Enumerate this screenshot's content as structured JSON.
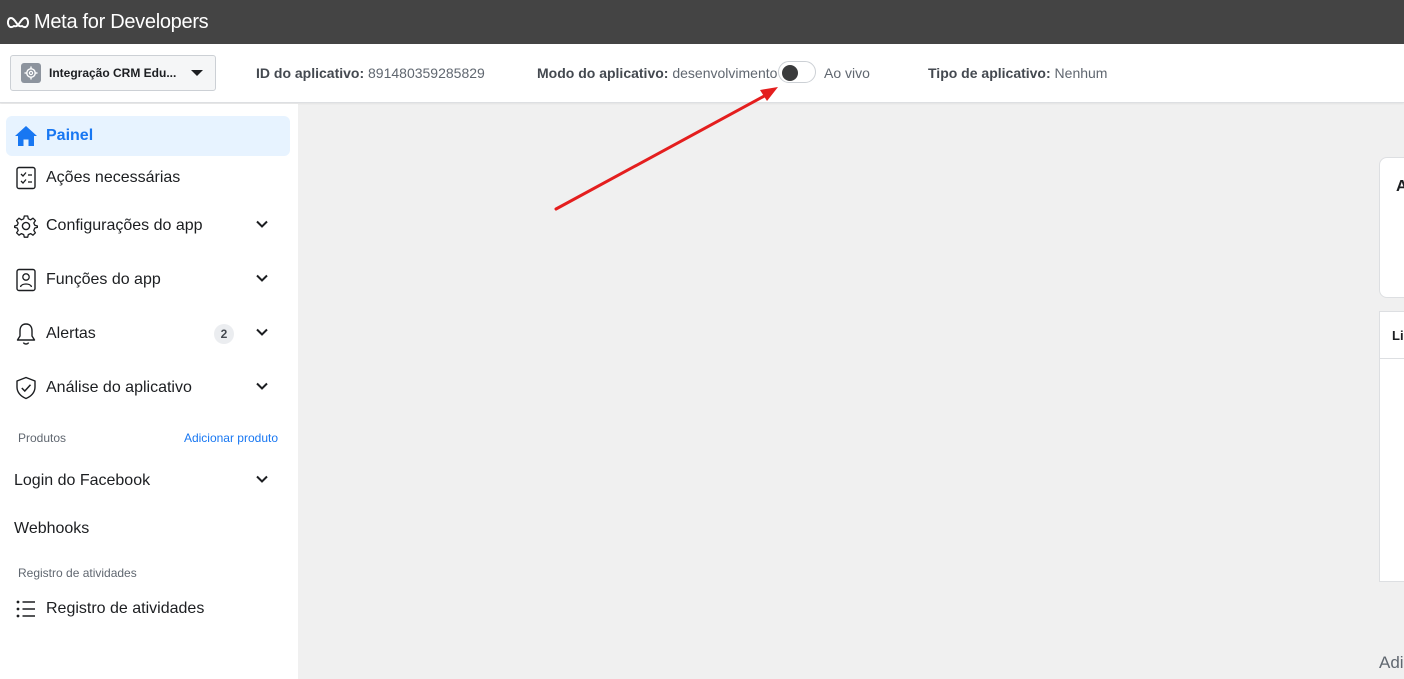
{
  "brand": {
    "name": "Meta for Developers"
  },
  "app_bar": {
    "app_name": "Integração CRM Edu...",
    "app_id_label": "ID do aplicativo:",
    "app_id_value": "891480359285829",
    "mode_label": "Modo do aplicativo:",
    "mode_value": "desenvolvimento",
    "mode_live_label": "Ao vivo",
    "mode_is_live": false,
    "type_label": "Tipo de aplicativo:",
    "type_value": "Nenhum"
  },
  "sidebar": {
    "items": [
      {
        "label": "Painel",
        "icon": "home-icon",
        "active": true
      },
      {
        "label": "Ações necessárias",
        "icon": "checklist-icon"
      },
      {
        "label": "Configurações do app",
        "icon": "gear-icon",
        "expandable": true
      },
      {
        "label": "Funções do app",
        "icon": "id-badge-icon",
        "expandable": true
      },
      {
        "label": "Alertas",
        "icon": "bell-icon",
        "expandable": true,
        "badge": "2"
      },
      {
        "label": "Análise do aplicativo",
        "icon": "shield-check-icon",
        "expandable": true
      }
    ],
    "products_section": {
      "label": "Produtos",
      "action": "Adicionar produto"
    },
    "products": [
      {
        "label": "Login do Facebook",
        "expandable": true
      },
      {
        "label": "Webhooks"
      }
    ],
    "activity_section": {
      "label": "Registro de atividades"
    },
    "activity_items": [
      {
        "label": "Registro de atividades",
        "icon": "list-icon"
      }
    ]
  },
  "main": {
    "card_title_partial": "A",
    "list_title_partial": "Li",
    "bottom_text_partial": "Adi"
  },
  "colors": {
    "topbar": "#444444",
    "accent": "#1877f2",
    "active_bg": "#e7f3ff",
    "annotation_arrow": "#e41e1e"
  }
}
